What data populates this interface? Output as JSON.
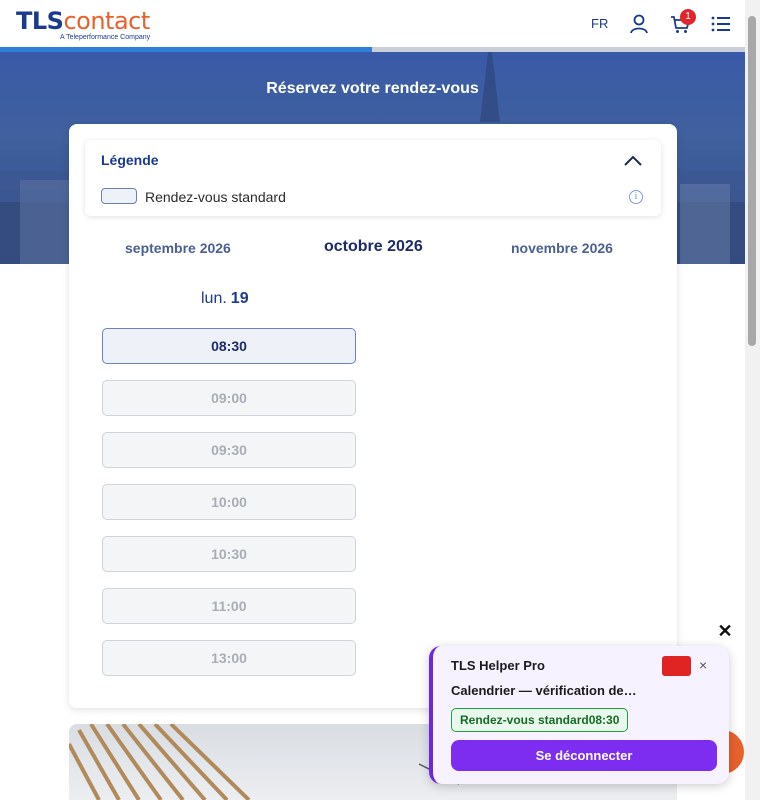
{
  "header": {
    "logo_main_a": "TLS",
    "logo_main_b": "contact",
    "logo_sub": "A Teleperformance Company",
    "lang": "FR",
    "cart_count": "1"
  },
  "progress": {
    "fraction": 0.5
  },
  "hero": {
    "title": "Réservez votre rendez-vous"
  },
  "legend": {
    "title": "Légende",
    "item_label": "Rendez-vous standard",
    "info_glyph": "i"
  },
  "months": {
    "prev": "septembre 2026",
    "current": "octobre 2026",
    "next": "novembre 2026"
  },
  "day": {
    "name": "lun.",
    "number": "19"
  },
  "slots": [
    {
      "time": "08:30",
      "available": true
    },
    {
      "time": "09:00",
      "available": false
    },
    {
      "time": "09:30",
      "available": false
    },
    {
      "time": "10:00",
      "available": false
    },
    {
      "time": "10:30",
      "available": false
    },
    {
      "time": "11:00",
      "available": false
    },
    {
      "time": "13:00",
      "available": false
    }
  ],
  "helper": {
    "close_x": "✕",
    "title": "TLS Helper Pro",
    "red_button_glyph": "",
    "close_glyph": "×",
    "status": "Calendrier — vérification des créneaux",
    "badge": "Rendez-vous standard08:30",
    "button": "Se déconnecter"
  },
  "colors": {
    "brand_blue": "#1a3a8f",
    "brand_orange": "#e8612c",
    "helper_purple": "#7c2df0"
  }
}
